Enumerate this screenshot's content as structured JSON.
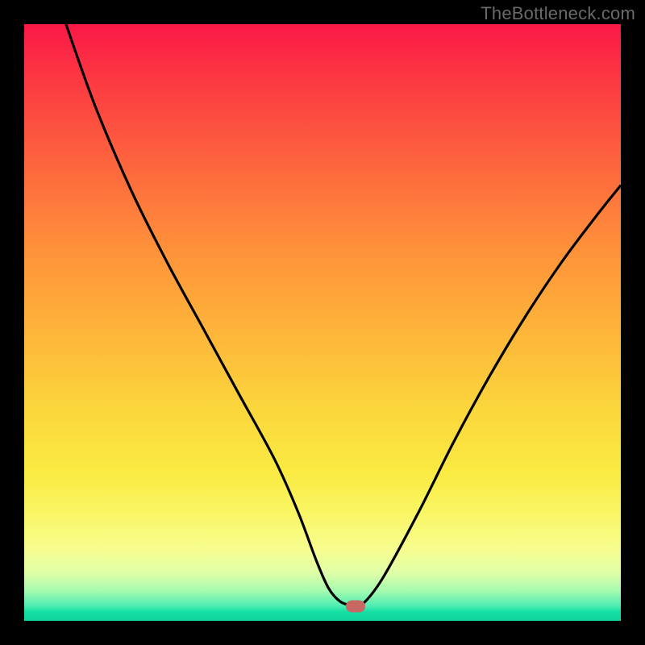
{
  "watermark": "TheBottleneck.com",
  "colors": {
    "frame_bg": "#000000",
    "watermark_text": "#6a6a6a",
    "curve_stroke": "#000000",
    "marker_fill": "#c76863",
    "gradient_stops": [
      "#fb1846",
      "#fc3b42",
      "#fd6a3d",
      "#fe923a",
      "#fdb63a",
      "#fbd53c",
      "#faea41",
      "#f9f665",
      "#f7fd8f",
      "#dffea7",
      "#a4fbb0",
      "#4eedb1",
      "#14dfa4",
      "#0fd49c"
    ]
  },
  "chart_data": {
    "type": "line",
    "title": "",
    "xlabel": "",
    "ylabel": "",
    "xlim": [
      0,
      100
    ],
    "ylim": [
      0,
      100
    ],
    "note": "x/y in percent of plot area; y=0 bottom, y=100 top. Values estimated from pixels.",
    "series": [
      {
        "name": "curve",
        "x": [
          7,
          12,
          18,
          24,
          30,
          36,
          42,
          46,
          49,
          51,
          53,
          55,
          56.5,
          60,
          66,
          72,
          78,
          84,
          90,
          96,
          100
        ],
        "y": [
          100,
          86,
          72,
          60,
          49,
          38,
          27,
          18,
          10,
          5.5,
          3.2,
          2.6,
          2.6,
          7,
          18,
          30,
          41,
          51,
          60,
          68,
          73
        ]
      }
    ],
    "marker": {
      "x": 55.5,
      "y": 2.4
    },
    "background": {
      "type": "vertical-gradient",
      "description": "red (top) → orange → yellow → pale → green (bottom)"
    }
  }
}
